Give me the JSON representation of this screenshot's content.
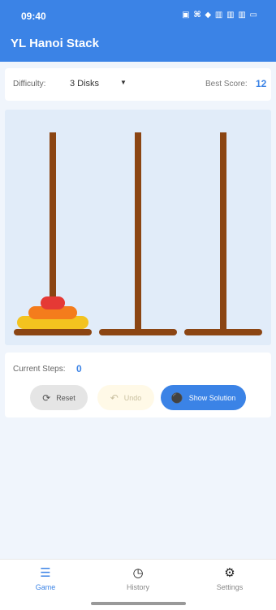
{
  "status_bar": {
    "time": "09:40",
    "icons": "▣ ⌘ ◆ ▥ ▥ ▥ ▭"
  },
  "app": {
    "title": "YL Hanoi Stack",
    "accent": "#3b83e6"
  },
  "controls": {
    "difficulty_label": "Difficulty:",
    "difficulty_value": "3 Disks",
    "best_score_label": "Best Score:",
    "best_score_value": "12"
  },
  "board": {
    "pole_color": "#8b4513",
    "pegs": [
      {
        "disks": [
          {
            "size": 3,
            "color": "#f3c31f"
          },
          {
            "size": 2,
            "color": "#f47c1c"
          },
          {
            "size": 1,
            "color": "#e53935"
          }
        ]
      },
      {
        "disks": []
      },
      {
        "disks": []
      }
    ]
  },
  "status": {
    "steps_label": "Current Steps:",
    "steps_value": "0",
    "buttons": {
      "reset": {
        "label": "Reset",
        "icon": "refresh-icon"
      },
      "undo": {
        "label": "Undo",
        "icon": "undo-icon"
      },
      "solution": {
        "label": "Show Solution",
        "icon": "lightbulb-icon"
      }
    }
  },
  "nav": [
    {
      "label": "Game",
      "icon": "stack-icon",
      "active": true
    },
    {
      "label": "History",
      "icon": "clock-icon",
      "active": false
    },
    {
      "label": "Settings",
      "icon": "gear-icon",
      "active": false
    }
  ]
}
